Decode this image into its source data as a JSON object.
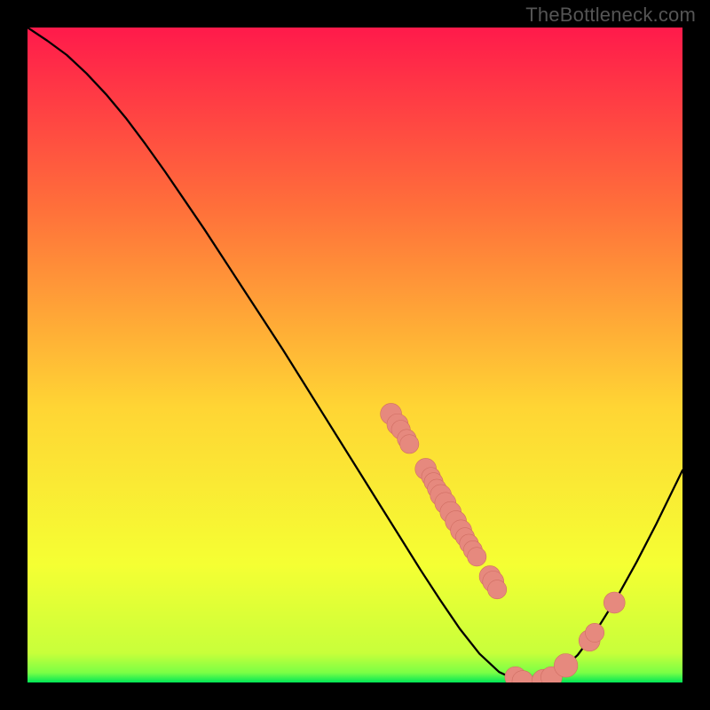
{
  "watermark": "TheBottleneck.com",
  "colors": {
    "background": "#000000",
    "gradient_top": "#ff1a4b",
    "gradient_mid_upper": "#ff713a",
    "gradient_mid": "#ffd534",
    "gradient_mid_lower": "#f5ff33",
    "gradient_bottom": "#00e756",
    "curve": "#000000",
    "marker_fill": "#e6897e",
    "marker_stroke": "#d06e63"
  },
  "chart_data": {
    "type": "line",
    "title": "",
    "xlabel": "",
    "ylabel": "",
    "xlim": [
      0,
      100
    ],
    "ylim": [
      0,
      100
    ],
    "curve": [
      {
        "x": 0.0,
        "y": 100.0
      },
      {
        "x": 3.0,
        "y": 98.0
      },
      {
        "x": 6.0,
        "y": 95.8
      },
      {
        "x": 9.0,
        "y": 93.0
      },
      {
        "x": 12.0,
        "y": 89.8
      },
      {
        "x": 15.0,
        "y": 86.2
      },
      {
        "x": 18.0,
        "y": 82.2
      },
      {
        "x": 21.0,
        "y": 78.0
      },
      {
        "x": 24.0,
        "y": 73.6
      },
      {
        "x": 27.0,
        "y": 69.2
      },
      {
        "x": 30.0,
        "y": 64.6
      },
      {
        "x": 33.0,
        "y": 60.0
      },
      {
        "x": 36.0,
        "y": 55.4
      },
      {
        "x": 39.0,
        "y": 50.8
      },
      {
        "x": 42.0,
        "y": 46.0
      },
      {
        "x": 45.0,
        "y": 41.2
      },
      {
        "x": 48.0,
        "y": 36.4
      },
      {
        "x": 51.0,
        "y": 31.6
      },
      {
        "x": 54.0,
        "y": 26.8
      },
      {
        "x": 57.0,
        "y": 22.0
      },
      {
        "x": 60.0,
        "y": 17.2
      },
      {
        "x": 63.0,
        "y": 12.6
      },
      {
        "x": 66.0,
        "y": 8.2
      },
      {
        "x": 69.0,
        "y": 4.4
      },
      {
        "x": 72.0,
        "y": 1.6
      },
      {
        "x": 75.0,
        "y": 0.2
      },
      {
        "x": 78.0,
        "y": 0.0
      },
      {
        "x": 81.0,
        "y": 1.4
      },
      {
        "x": 84.0,
        "y": 4.2
      },
      {
        "x": 87.0,
        "y": 8.2
      },
      {
        "x": 90.0,
        "y": 13.0
      },
      {
        "x": 93.0,
        "y": 18.4
      },
      {
        "x": 96.0,
        "y": 24.2
      },
      {
        "x": 100.0,
        "y": 32.4
      }
    ],
    "markers": [
      {
        "x": 55.5,
        "y": 41.0,
        "r": 1.2
      },
      {
        "x": 56.5,
        "y": 39.4,
        "r": 1.2
      },
      {
        "x": 57.0,
        "y": 38.6,
        "r": 1.0
      },
      {
        "x": 57.9,
        "y": 37.2,
        "r": 1.0
      },
      {
        "x": 58.3,
        "y": 36.4,
        "r": 1.0
      },
      {
        "x": 60.8,
        "y": 32.6,
        "r": 1.2
      },
      {
        "x": 61.6,
        "y": 31.4,
        "r": 1.0
      },
      {
        "x": 62.0,
        "y": 30.6,
        "r": 1.0
      },
      {
        "x": 62.5,
        "y": 29.6,
        "r": 1.0
      },
      {
        "x": 63.1,
        "y": 28.6,
        "r": 1.2
      },
      {
        "x": 63.8,
        "y": 27.4,
        "r": 1.2
      },
      {
        "x": 64.6,
        "y": 26.0,
        "r": 1.2
      },
      {
        "x": 65.4,
        "y": 24.6,
        "r": 1.2
      },
      {
        "x": 66.2,
        "y": 23.2,
        "r": 1.2
      },
      {
        "x": 66.8,
        "y": 22.2,
        "r": 1.0
      },
      {
        "x": 67.4,
        "y": 21.2,
        "r": 1.0
      },
      {
        "x": 68.0,
        "y": 20.2,
        "r": 1.0
      },
      {
        "x": 68.6,
        "y": 19.2,
        "r": 1.0
      },
      {
        "x": 70.6,
        "y": 16.2,
        "r": 1.2
      },
      {
        "x": 71.1,
        "y": 15.4,
        "r": 1.2
      },
      {
        "x": 71.7,
        "y": 14.2,
        "r": 1.0
      },
      {
        "x": 74.5,
        "y": 0.8,
        "r": 1.2
      },
      {
        "x": 75.6,
        "y": 0.2,
        "r": 1.2
      },
      {
        "x": 78.8,
        "y": 0.2,
        "r": 1.4
      },
      {
        "x": 80.0,
        "y": 0.8,
        "r": 1.2
      },
      {
        "x": 82.2,
        "y": 2.6,
        "r": 1.4
      },
      {
        "x": 85.8,
        "y": 6.4,
        "r": 1.2
      },
      {
        "x": 86.6,
        "y": 7.6,
        "r": 1.0
      },
      {
        "x": 89.6,
        "y": 12.2,
        "r": 1.2
      }
    ]
  }
}
